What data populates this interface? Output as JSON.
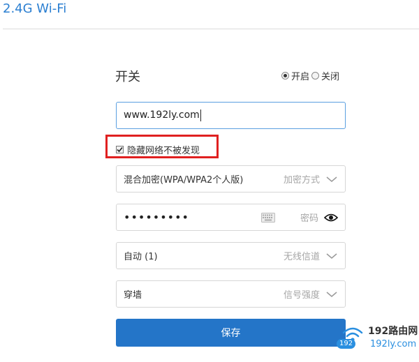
{
  "page": {
    "title": "2.4G Wi-Fi"
  },
  "switch": {
    "label": "开关",
    "options": [
      "开启",
      "关闭"
    ],
    "selected": "开启"
  },
  "ssid": {
    "value": "www.192ly.com"
  },
  "hide_network": {
    "label": "隐藏网络不被发现",
    "checked": true
  },
  "encryption": {
    "value": "混合加密(WPA/WPA2个人版)",
    "hint": "加密方式"
  },
  "password": {
    "masked": "•••••••••",
    "hint": "密码"
  },
  "channel": {
    "value": "自动 (1)",
    "hint": "无线信道"
  },
  "signal": {
    "value": "穿墙",
    "hint": "信号强度"
  },
  "save_label": "保存",
  "watermark": {
    "text1": "192路由网",
    "badge": "192",
    "text2": "192ly.com"
  },
  "colors": {
    "accent": "#2475c8",
    "highlight": "#e02020",
    "title": "#2b7fd1"
  },
  "icons": [
    "radio-icon",
    "checkbox-icon",
    "chevron-down-icon",
    "keyboard-icon",
    "eye-icon",
    "wifi-icon"
  ]
}
